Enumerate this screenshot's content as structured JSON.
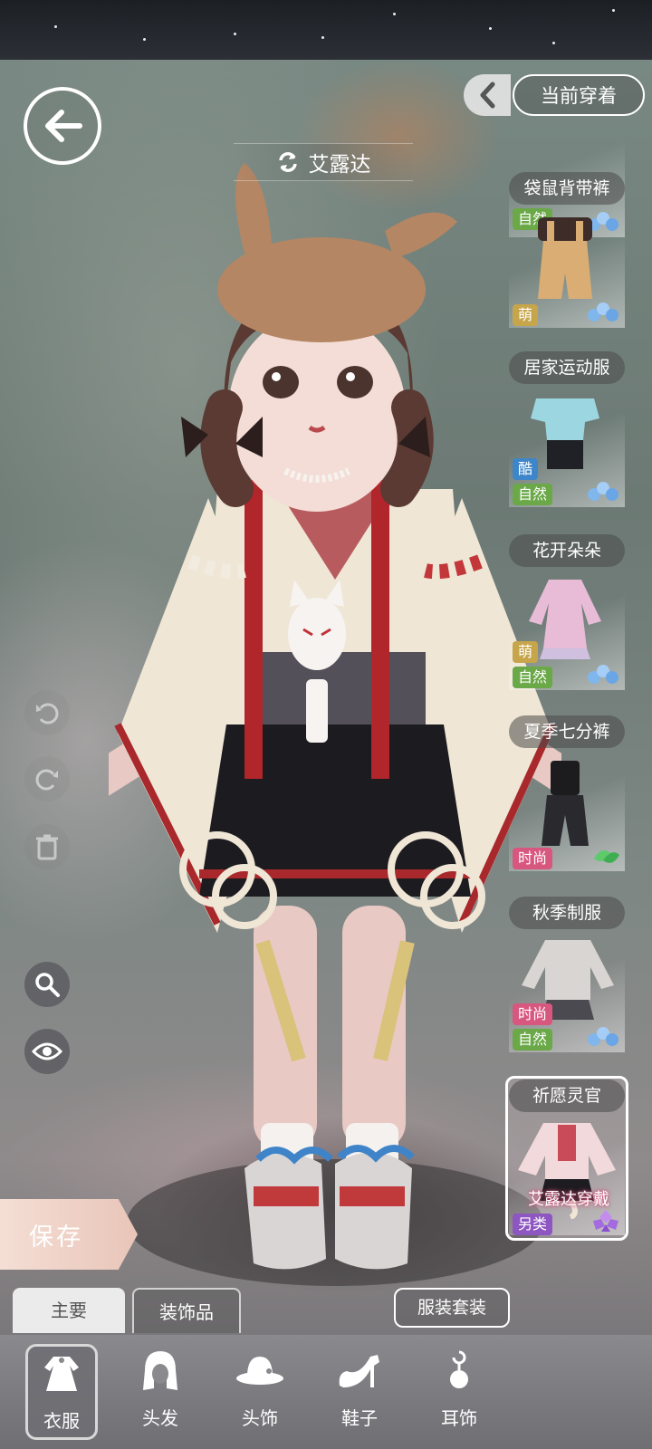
{
  "header": {
    "character_name": "艾露达",
    "current_wear_label": "当前穿着"
  },
  "outfit_panel": {
    "items": [
      {
        "name": "",
        "tags": [
          {
            "text": "自然",
            "color": "#6aa848"
          }
        ],
        "gem": "blue"
      },
      {
        "name": "袋鼠背带裤",
        "tags": [
          {
            "text": "萌",
            "color": "#c7a54a"
          }
        ],
        "gem": "blue"
      },
      {
        "name": "居家运动服",
        "tags": [
          {
            "text": "酷",
            "color": "#3e86c9"
          },
          {
            "text": "自然",
            "color": "#6aa848"
          }
        ],
        "gem": "blue"
      },
      {
        "name": "花开朵朵",
        "tags": [
          {
            "text": "萌",
            "color": "#c7a54a"
          },
          {
            "text": "自然",
            "color": "#6aa848"
          }
        ],
        "gem": "blue"
      },
      {
        "name": "夏季七分裤",
        "tags": [
          {
            "text": "时尚",
            "color": "#d8577f"
          }
        ],
        "gem": "green"
      },
      {
        "name": "秋季制服",
        "tags": [
          {
            "text": "时尚",
            "color": "#d8577f"
          },
          {
            "text": "自然",
            "color": "#6aa848"
          }
        ],
        "gem": "blue"
      },
      {
        "name": "祈愿灵官",
        "tags": [
          {
            "text": "另类",
            "color": "#8d56c0"
          }
        ],
        "gem": "purple",
        "selected": true,
        "hint": "艾露达穿戴"
      }
    ]
  },
  "actions": {
    "save_label": "保存",
    "suit_label": "服装套装"
  },
  "tabs": [
    {
      "label": "主要",
      "active": true
    },
    {
      "label": "装饰品",
      "active": false
    }
  ],
  "bottom_nav": [
    {
      "label": "衣服",
      "icon": "dress-icon",
      "active": true
    },
    {
      "label": "头发",
      "icon": "hair-icon",
      "active": false
    },
    {
      "label": "头饰",
      "icon": "hat-icon",
      "active": false
    },
    {
      "label": "鞋子",
      "icon": "high-heel-icon",
      "active": false
    },
    {
      "label": "耳饰",
      "icon": "earring-icon",
      "active": false
    }
  ]
}
